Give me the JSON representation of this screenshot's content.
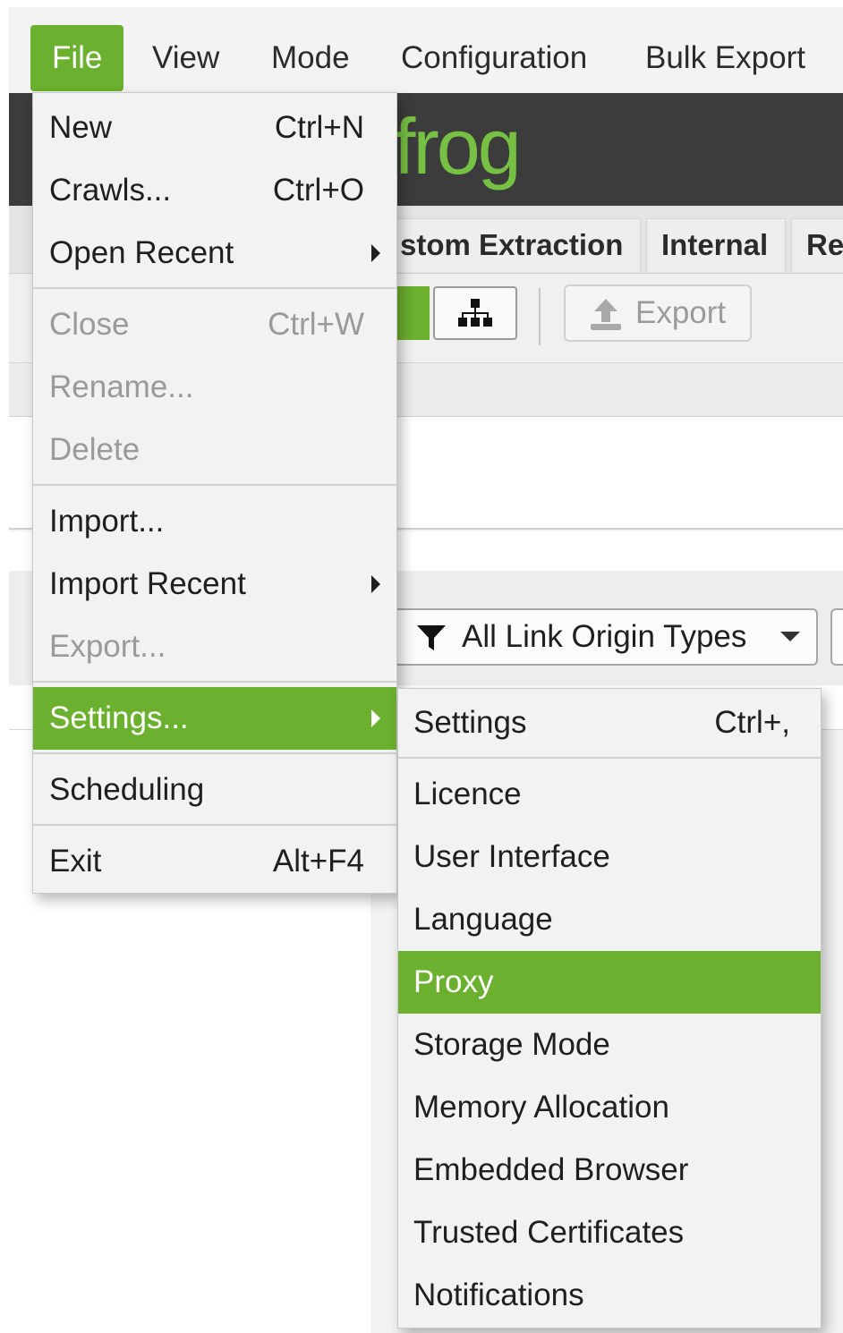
{
  "menubar": {
    "items": [
      {
        "label": "File"
      },
      {
        "label": "View"
      },
      {
        "label": "Mode"
      },
      {
        "label": "Configuration"
      },
      {
        "label": "Bulk Export"
      }
    ]
  },
  "brand": {
    "logo_text": "frog"
  },
  "tabs": [
    {
      "label": "stom Extraction"
    },
    {
      "label": "Internal"
    },
    {
      "label": "Re"
    }
  ],
  "toolbar": {
    "export_label": "Export"
  },
  "filters": {
    "origin_types_label": "All Link Origin Types"
  },
  "file_menu": {
    "items": [
      {
        "label": "New",
        "shortcut": "Ctrl+N"
      },
      {
        "label": "Crawls...",
        "shortcut": "Ctrl+O"
      },
      {
        "label": "Open Recent"
      },
      {
        "label": "Close",
        "shortcut": "Ctrl+W"
      },
      {
        "label": "Rename..."
      },
      {
        "label": "Delete"
      },
      {
        "label": "Import..."
      },
      {
        "label": "Import Recent"
      },
      {
        "label": "Export..."
      },
      {
        "label": "Settings..."
      },
      {
        "label": "Scheduling"
      },
      {
        "label": "Exit",
        "shortcut": "Alt+F4"
      }
    ]
  },
  "settings_menu": {
    "items": [
      {
        "label": "Settings",
        "shortcut": "Ctrl+,"
      },
      {
        "label": "Licence"
      },
      {
        "label": "User Interface"
      },
      {
        "label": "Language"
      },
      {
        "label": "Proxy"
      },
      {
        "label": "Storage Mode"
      },
      {
        "label": "Memory Allocation"
      },
      {
        "label": "Embedded Browser"
      },
      {
        "label": "Trusted Certificates"
      },
      {
        "label": "Notifications"
      }
    ]
  },
  "colors": {
    "accent_green": "#6bb02e",
    "brand_bar": "#3c3c3c",
    "menu_bg": "#f2f2f2",
    "disabled_text": "#9a9a9a"
  }
}
